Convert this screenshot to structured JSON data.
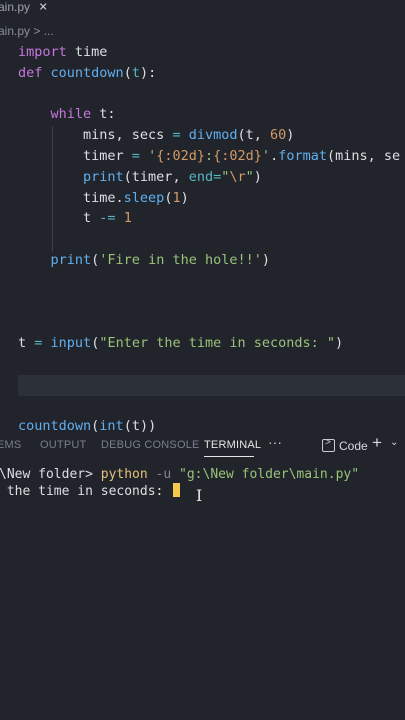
{
  "tab": {
    "filename": "ain.py",
    "close_glyph": "×"
  },
  "breadcrumb": "ain.py > ...",
  "code_lines": [
    {
      "tokens": [
        {
          "t": "import",
          "c": "kw"
        },
        {
          "t": " time",
          "c": "plain"
        }
      ]
    },
    {
      "tokens": [
        {
          "t": "def",
          "c": "kw"
        },
        {
          "t": " ",
          "c": "plain"
        },
        {
          "t": "countdown",
          "c": "fn"
        },
        {
          "t": "(",
          "c": "plain"
        },
        {
          "t": "t",
          "c": "par"
        },
        {
          "t": "):",
          "c": "plain"
        }
      ]
    },
    {
      "tokens": []
    },
    {
      "tokens": [
        {
          "t": "    ",
          "c": "plain"
        },
        {
          "t": "while",
          "c": "kw"
        },
        {
          "t": " t:",
          "c": "plain"
        }
      ]
    },
    {
      "tokens": [
        {
          "t": "        mins, secs ",
          "c": "plain"
        },
        {
          "t": "=",
          "c": "op"
        },
        {
          "t": " ",
          "c": "plain"
        },
        {
          "t": "divmod",
          "c": "fn"
        },
        {
          "t": "(t, ",
          "c": "plain"
        },
        {
          "t": "60",
          "c": "num"
        },
        {
          "t": ")",
          "c": "plain"
        }
      ]
    },
    {
      "tokens": [
        {
          "t": "        timer ",
          "c": "plain"
        },
        {
          "t": "=",
          "c": "op"
        },
        {
          "t": " ",
          "c": "plain"
        },
        {
          "t": "'",
          "c": "str"
        },
        {
          "t": "{:02d}",
          "c": "esc"
        },
        {
          "t": ":",
          "c": "str"
        },
        {
          "t": "{:02d}",
          "c": "esc"
        },
        {
          "t": "'",
          "c": "str"
        },
        {
          "t": ".",
          "c": "plain"
        },
        {
          "t": "format",
          "c": "fn"
        },
        {
          "t": "(mins, se",
          "c": "plain"
        }
      ]
    },
    {
      "tokens": [
        {
          "t": "        ",
          "c": "plain"
        },
        {
          "t": "print",
          "c": "fn"
        },
        {
          "t": "(timer, ",
          "c": "plain"
        },
        {
          "t": "end",
          "c": "par"
        },
        {
          "t": "=",
          "c": "op"
        },
        {
          "t": "\"",
          "c": "str"
        },
        {
          "t": "\\r",
          "c": "esc"
        },
        {
          "t": "\"",
          "c": "str"
        },
        {
          "t": ")",
          "c": "plain"
        }
      ]
    },
    {
      "tokens": [
        {
          "t": "        time.",
          "c": "plain"
        },
        {
          "t": "sleep",
          "c": "fn"
        },
        {
          "t": "(",
          "c": "plain"
        },
        {
          "t": "1",
          "c": "num"
        },
        {
          "t": ")",
          "c": "plain"
        }
      ]
    },
    {
      "tokens": [
        {
          "t": "        t ",
          "c": "plain"
        },
        {
          "t": "-=",
          "c": "op"
        },
        {
          "t": " ",
          "c": "plain"
        },
        {
          "t": "1",
          "c": "num"
        }
      ]
    },
    {
      "tokens": []
    },
    {
      "tokens": [
        {
          "t": "    ",
          "c": "plain"
        },
        {
          "t": "print",
          "c": "fn"
        },
        {
          "t": "(",
          "c": "plain"
        },
        {
          "t": "'Fire in the hole!!'",
          "c": "str"
        },
        {
          "t": ")",
          "c": "plain"
        }
      ]
    },
    {
      "tokens": []
    },
    {
      "tokens": []
    },
    {
      "tokens": []
    },
    {
      "tokens": [
        {
          "t": "t ",
          "c": "plain"
        },
        {
          "t": "=",
          "c": "op"
        },
        {
          "t": " ",
          "c": "plain"
        },
        {
          "t": "input",
          "c": "fn"
        },
        {
          "t": "(",
          "c": "plain"
        },
        {
          "t": "\"Enter the time in seconds: \"",
          "c": "str"
        },
        {
          "t": ")",
          "c": "plain"
        }
      ]
    },
    {
      "tokens": []
    },
    {
      "tokens": [],
      "current": true
    },
    {
      "tokens": []
    },
    {
      "tokens": [
        {
          "t": "countdown",
          "c": "fn"
        },
        {
          "t": "(",
          "c": "plain"
        },
        {
          "t": "int",
          "c": "fn"
        },
        {
          "t": "(t))",
          "c": "plain"
        }
      ]
    }
  ],
  "panel": {
    "tabs": [
      {
        "label": "EMS",
        "active": false
      },
      {
        "label": "OUTPUT",
        "active": false
      },
      {
        "label": "DEBUG CONSOLE",
        "active": false
      },
      {
        "label": "TERMINAL",
        "active": true
      }
    ],
    "more_glyph": "···",
    "profile_label": "Code",
    "plus_glyph": "+",
    "chevron_glyph": "⌄"
  },
  "terminal": {
    "prompt_path": "\\New folder> ",
    "command": "python",
    "flag": " -u ",
    "arg": "\"g:\\New folder\\main.py\"",
    "output": " the time in seconds: "
  }
}
